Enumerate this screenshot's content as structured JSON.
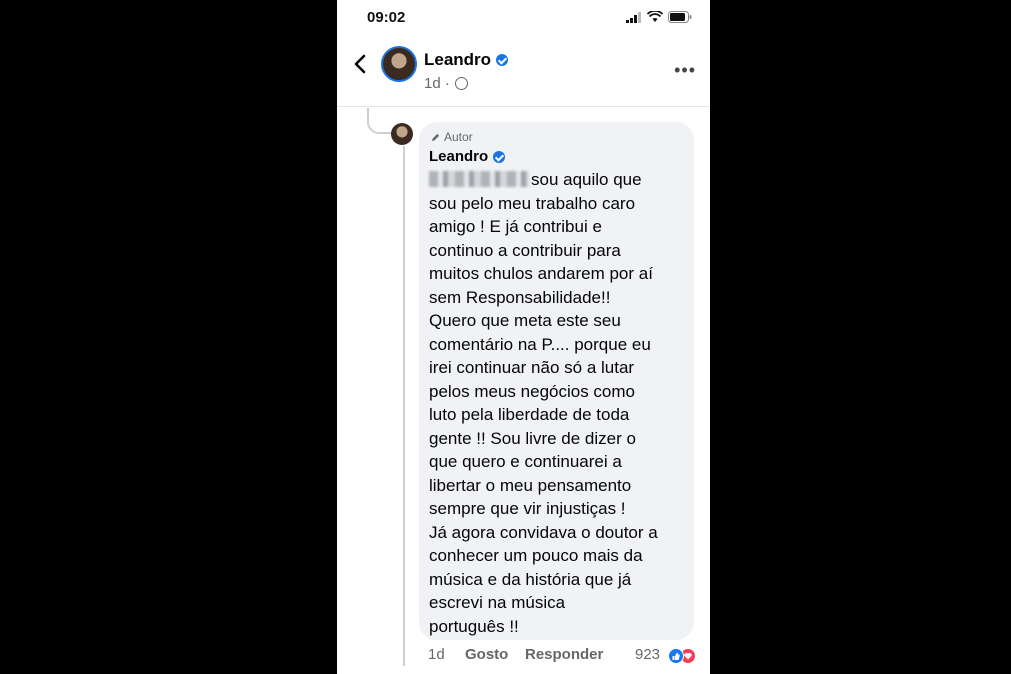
{
  "status_bar": {
    "time": "09:02"
  },
  "header": {
    "name": "Leandro",
    "meta": "1d ·"
  },
  "comment": {
    "author_badge": "Autor",
    "name": "Leandro",
    "lines": [
      "sou aquilo que",
      "sou pelo meu trabalho caro",
      "amigo ! E já contribui e",
      "continuo a contribuir para",
      "muitos chulos andarem por aí",
      "sem Responsabilidade!!",
      "Quero que meta este seu",
      "comentário na P.... porque eu",
      "irei continuar não só a lutar",
      "pelos meus negócios como",
      "luto pela liberdade de toda",
      "gente !! Sou livre de dizer o",
      "que quero e continuarei a",
      "libertar o meu pensamento",
      "sempre que vir injustiças !",
      "Já agora convidava o doutor a",
      "conhecer um pouco mais da",
      "música e da história que já",
      "escrevi na música",
      "português  !!"
    ]
  },
  "footer": {
    "time": "1d",
    "like": "Gosto",
    "reply": "Responder",
    "reactions_count": "923"
  },
  "colors": {
    "facebook_blue": "#1b74e4",
    "like_blue": "#1877f2",
    "love_red": "#f33e58",
    "bubble_bg": "#f0f2f5"
  }
}
